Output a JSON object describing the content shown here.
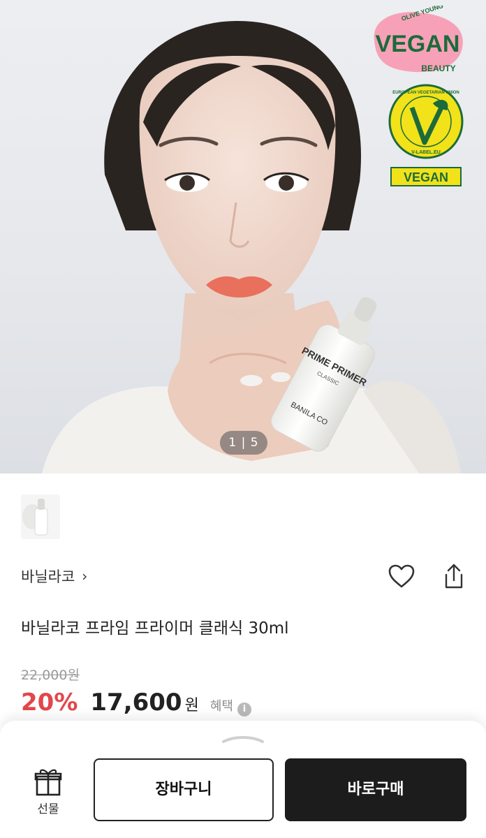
{
  "hero": {
    "image_counter": "1 | 5",
    "product_bottle_text": "PRIME PRIMER",
    "product_bottle_subtext": "CLASSIC",
    "product_bottle_brand": "BANILA CO",
    "badges": {
      "vegan_beauty": {
        "top": "OLIVE YOUNG",
        "main": "VEGAN",
        "bottom": "BEAUTY",
        "color": "#f7a1b8"
      },
      "vlabel": {
        "ring_text": "EUROPEAN VEGETARIAN UNION",
        "url": "V-LABEL.EU",
        "bottom": "VEGAN",
        "color": "#f2e21a"
      }
    }
  },
  "product": {
    "brand_name": "바닐라코",
    "brand_chevron": "›",
    "title": "바닐라코 프라임 프라이머 클래식 30ml",
    "original_price": "22,000원",
    "discount_rate": "20%",
    "sale_price": "17,600",
    "currency": "원",
    "benefit_label": "혜택",
    "info_icon": "i"
  },
  "icons": {
    "heart": "heart-outline-icon",
    "share": "share-icon",
    "gift": "gift-box-icon",
    "handle": "chevron-handle-icon"
  },
  "bottom_bar": {
    "gift_label": "선물",
    "cart_label": "장바구니",
    "buy_label": "바로구매"
  },
  "colors": {
    "discount_red": "#e2474b",
    "buy_button_bg": "#1c1c1c",
    "text_primary": "#222222"
  }
}
